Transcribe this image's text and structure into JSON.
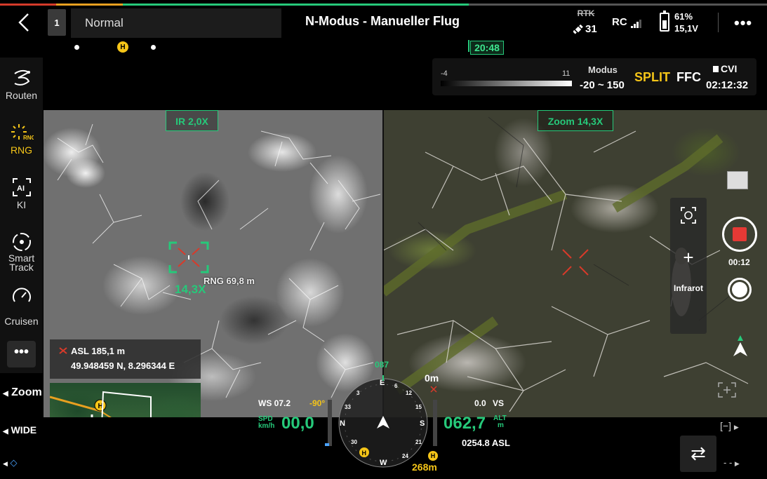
{
  "topbar": {
    "seq_number": "1",
    "mode_select_value": "Normal",
    "title": "N-Modus - Manueller Flug",
    "rtk_label": "RTK",
    "satellite_count": "31",
    "rc_label": "RC",
    "battery_percent": "61%",
    "battery_voltage": "15,1V",
    "battery_level": 0.61,
    "more_label": "•••"
  },
  "timeline": {
    "time_remaining": "20:48",
    "home_marker": "H"
  },
  "camera_panel": {
    "ir_min": "-4",
    "ir_max": "11",
    "modus_label": "Modus",
    "modus_value": "-20 ~ 150",
    "split_label": "SPLIT",
    "ffc_label": "FFC",
    "storage_label": "CVI",
    "rec_time": "02:12:32"
  },
  "sidebar": {
    "items": [
      {
        "label": "Routen",
        "icon": "route-icon"
      },
      {
        "label": "RNG",
        "icon": "rng-icon",
        "icon_text": "RNG",
        "active": true
      },
      {
        "label": "KI",
        "icon": "ai-icon",
        "icon_text": "AI"
      },
      {
        "label": "Smart Track",
        "icon": "smart-track-icon"
      },
      {
        "label": "Cruisen",
        "icon": "speedometer-icon"
      }
    ],
    "more_label": "•••",
    "zoom_label": "Zoom",
    "wide_label": "WIDE"
  },
  "views": {
    "ir_label": "IR 2,0X",
    "zoom_label": "Zoom 14,3X",
    "ir_zoom_level": "14,3X",
    "rng_readout": "RNG 69,8 m"
  },
  "camera_controls": {
    "plus_label": "+",
    "infrarot_label": "Infrarot",
    "record_timer": "00:12"
  },
  "location": {
    "asl": "ASL 185,1 m",
    "coordinates": "49.948459 N, 8.296344 E"
  },
  "flight": {
    "ws_label": "WS 07.2",
    "ws_angle": "-90°",
    "spd_unit_top": "SPD",
    "spd_unit_bottom": "km/h",
    "speed": "00,0",
    "altitude": "062,7",
    "alt_unit_top": "ALT",
    "alt_unit_bottom": "m",
    "vs_value": "0.0",
    "vs_label": "VS",
    "asl_value": "0254.8 ASL",
    "heading": "087",
    "distance_top": "0m",
    "home_distance": "268m",
    "compass_letters": [
      "E",
      "S",
      "W",
      "N"
    ],
    "compass_numbers": [
      "12",
      "15",
      "21",
      "24",
      "30",
      "33",
      "3",
      "6"
    ]
  },
  "bottom_right": {
    "minus_label": "[−]",
    "dash_label": "- -",
    "swap_icon": "swap-icon"
  },
  "colors": {
    "accent_green": "#26c97a",
    "warning_yellow": "#f5c518",
    "record_red": "#e53935",
    "timeline_red": "#d43a2a",
    "timeline_orange": "#e8a020"
  }
}
